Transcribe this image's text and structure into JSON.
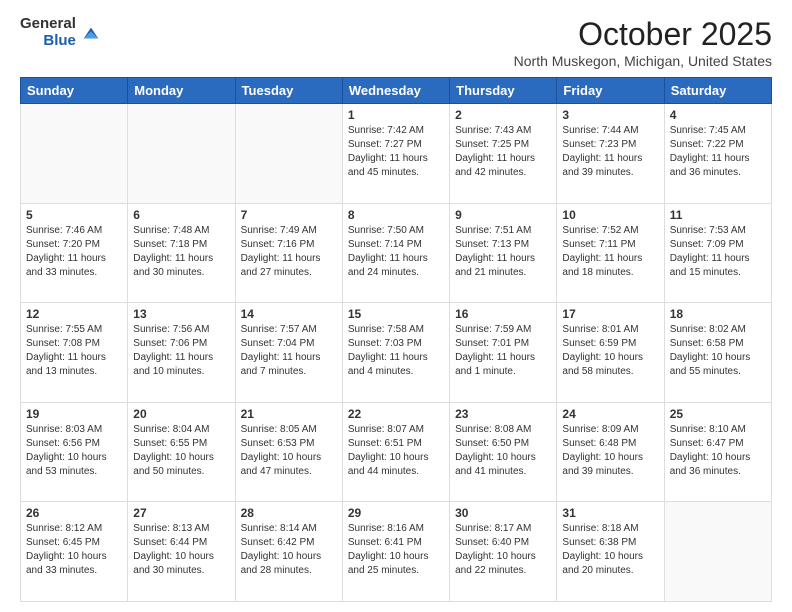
{
  "header": {
    "logo_general": "General",
    "logo_blue": "Blue",
    "month_title": "October 2025",
    "subtitle": "North Muskegon, Michigan, United States"
  },
  "days_of_week": [
    "Sunday",
    "Monday",
    "Tuesday",
    "Wednesday",
    "Thursday",
    "Friday",
    "Saturday"
  ],
  "weeks": [
    [
      {
        "day": "",
        "sunrise": "",
        "sunset": "",
        "daylight": ""
      },
      {
        "day": "",
        "sunrise": "",
        "sunset": "",
        "daylight": ""
      },
      {
        "day": "",
        "sunrise": "",
        "sunset": "",
        "daylight": ""
      },
      {
        "day": "1",
        "sunrise": "Sunrise: 7:42 AM",
        "sunset": "Sunset: 7:27 PM",
        "daylight": "Daylight: 11 hours and 45 minutes."
      },
      {
        "day": "2",
        "sunrise": "Sunrise: 7:43 AM",
        "sunset": "Sunset: 7:25 PM",
        "daylight": "Daylight: 11 hours and 42 minutes."
      },
      {
        "day": "3",
        "sunrise": "Sunrise: 7:44 AM",
        "sunset": "Sunset: 7:23 PM",
        "daylight": "Daylight: 11 hours and 39 minutes."
      },
      {
        "day": "4",
        "sunrise": "Sunrise: 7:45 AM",
        "sunset": "Sunset: 7:22 PM",
        "daylight": "Daylight: 11 hours and 36 minutes."
      }
    ],
    [
      {
        "day": "5",
        "sunrise": "Sunrise: 7:46 AM",
        "sunset": "Sunset: 7:20 PM",
        "daylight": "Daylight: 11 hours and 33 minutes."
      },
      {
        "day": "6",
        "sunrise": "Sunrise: 7:48 AM",
        "sunset": "Sunset: 7:18 PM",
        "daylight": "Daylight: 11 hours and 30 minutes."
      },
      {
        "day": "7",
        "sunrise": "Sunrise: 7:49 AM",
        "sunset": "Sunset: 7:16 PM",
        "daylight": "Daylight: 11 hours and 27 minutes."
      },
      {
        "day": "8",
        "sunrise": "Sunrise: 7:50 AM",
        "sunset": "Sunset: 7:14 PM",
        "daylight": "Daylight: 11 hours and 24 minutes."
      },
      {
        "day": "9",
        "sunrise": "Sunrise: 7:51 AM",
        "sunset": "Sunset: 7:13 PM",
        "daylight": "Daylight: 11 hours and 21 minutes."
      },
      {
        "day": "10",
        "sunrise": "Sunrise: 7:52 AM",
        "sunset": "Sunset: 7:11 PM",
        "daylight": "Daylight: 11 hours and 18 minutes."
      },
      {
        "day": "11",
        "sunrise": "Sunrise: 7:53 AM",
        "sunset": "Sunset: 7:09 PM",
        "daylight": "Daylight: 11 hours and 15 minutes."
      }
    ],
    [
      {
        "day": "12",
        "sunrise": "Sunrise: 7:55 AM",
        "sunset": "Sunset: 7:08 PM",
        "daylight": "Daylight: 11 hours and 13 minutes."
      },
      {
        "day": "13",
        "sunrise": "Sunrise: 7:56 AM",
        "sunset": "Sunset: 7:06 PM",
        "daylight": "Daylight: 11 hours and 10 minutes."
      },
      {
        "day": "14",
        "sunrise": "Sunrise: 7:57 AM",
        "sunset": "Sunset: 7:04 PM",
        "daylight": "Daylight: 11 hours and 7 minutes."
      },
      {
        "day": "15",
        "sunrise": "Sunrise: 7:58 AM",
        "sunset": "Sunset: 7:03 PM",
        "daylight": "Daylight: 11 hours and 4 minutes."
      },
      {
        "day": "16",
        "sunrise": "Sunrise: 7:59 AM",
        "sunset": "Sunset: 7:01 PM",
        "daylight": "Daylight: 11 hours and 1 minute."
      },
      {
        "day": "17",
        "sunrise": "Sunrise: 8:01 AM",
        "sunset": "Sunset: 6:59 PM",
        "daylight": "Daylight: 10 hours and 58 minutes."
      },
      {
        "day": "18",
        "sunrise": "Sunrise: 8:02 AM",
        "sunset": "Sunset: 6:58 PM",
        "daylight": "Daylight: 10 hours and 55 minutes."
      }
    ],
    [
      {
        "day": "19",
        "sunrise": "Sunrise: 8:03 AM",
        "sunset": "Sunset: 6:56 PM",
        "daylight": "Daylight: 10 hours and 53 minutes."
      },
      {
        "day": "20",
        "sunrise": "Sunrise: 8:04 AM",
        "sunset": "Sunset: 6:55 PM",
        "daylight": "Daylight: 10 hours and 50 minutes."
      },
      {
        "day": "21",
        "sunrise": "Sunrise: 8:05 AM",
        "sunset": "Sunset: 6:53 PM",
        "daylight": "Daylight: 10 hours and 47 minutes."
      },
      {
        "day": "22",
        "sunrise": "Sunrise: 8:07 AM",
        "sunset": "Sunset: 6:51 PM",
        "daylight": "Daylight: 10 hours and 44 minutes."
      },
      {
        "day": "23",
        "sunrise": "Sunrise: 8:08 AM",
        "sunset": "Sunset: 6:50 PM",
        "daylight": "Daylight: 10 hours and 41 minutes."
      },
      {
        "day": "24",
        "sunrise": "Sunrise: 8:09 AM",
        "sunset": "Sunset: 6:48 PM",
        "daylight": "Daylight: 10 hours and 39 minutes."
      },
      {
        "day": "25",
        "sunrise": "Sunrise: 8:10 AM",
        "sunset": "Sunset: 6:47 PM",
        "daylight": "Daylight: 10 hours and 36 minutes."
      }
    ],
    [
      {
        "day": "26",
        "sunrise": "Sunrise: 8:12 AM",
        "sunset": "Sunset: 6:45 PM",
        "daylight": "Daylight: 10 hours and 33 minutes."
      },
      {
        "day": "27",
        "sunrise": "Sunrise: 8:13 AM",
        "sunset": "Sunset: 6:44 PM",
        "daylight": "Daylight: 10 hours and 30 minutes."
      },
      {
        "day": "28",
        "sunrise": "Sunrise: 8:14 AM",
        "sunset": "Sunset: 6:42 PM",
        "daylight": "Daylight: 10 hours and 28 minutes."
      },
      {
        "day": "29",
        "sunrise": "Sunrise: 8:16 AM",
        "sunset": "Sunset: 6:41 PM",
        "daylight": "Daylight: 10 hours and 25 minutes."
      },
      {
        "day": "30",
        "sunrise": "Sunrise: 8:17 AM",
        "sunset": "Sunset: 6:40 PM",
        "daylight": "Daylight: 10 hours and 22 minutes."
      },
      {
        "day": "31",
        "sunrise": "Sunrise: 8:18 AM",
        "sunset": "Sunset: 6:38 PM",
        "daylight": "Daylight: 10 hours and 20 minutes."
      },
      {
        "day": "",
        "sunrise": "",
        "sunset": "",
        "daylight": ""
      }
    ]
  ]
}
